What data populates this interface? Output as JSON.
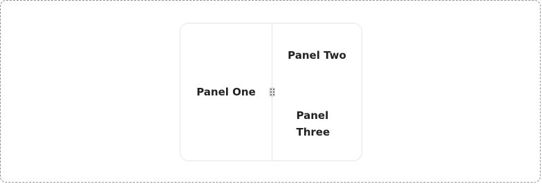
{
  "panels": {
    "left": "Panel One",
    "top_right": "Panel Two",
    "bottom_right": "Panel Three"
  },
  "handle": {
    "icon": "grip-dots-icon"
  }
}
